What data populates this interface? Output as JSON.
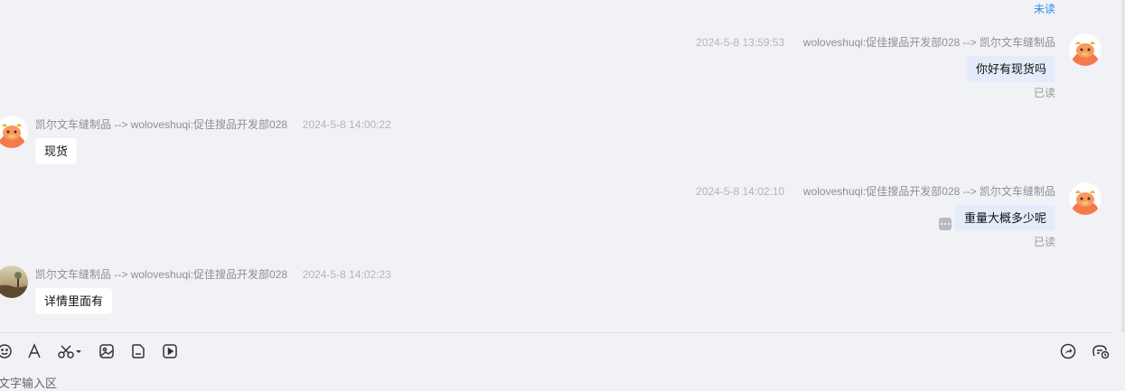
{
  "messages": [
    {
      "status": "未读"
    },
    {
      "direction": "out",
      "time": "2024-5-8 13:59:53",
      "sender": "woloveshuqi:促佳搜品开发部028 --> 凯尔文车缝制品",
      "text": "你好有现货吗",
      "status": "已读"
    },
    {
      "direction": "in",
      "sender": "凯尔文车缝制品 --> woloveshuqi:促佳搜品开发部028",
      "time": "2024-5-8 14:00:22",
      "text": "现货"
    },
    {
      "direction": "out",
      "time": "2024-5-8 14:02:10",
      "sender": "woloveshuqi:促佳搜品开发部028 --> 凯尔文车缝制品",
      "text": "重量大概多少呢",
      "status": "已读"
    },
    {
      "direction": "in",
      "sender": "凯尔文车缝制品 --> woloveshuqi:促佳搜品开发部028",
      "time": "2024-5-8 14:02:23",
      "text": "详情里面有"
    }
  ],
  "toolbar": {
    "left_icons": [
      "emoji-icon",
      "font-icon",
      "scissors-icon",
      "image-icon",
      "file-icon",
      "video-icon"
    ],
    "right_icons": [
      "share-icon",
      "quick-reply-icon"
    ]
  },
  "input": {
    "placeholder": "文字输入区"
  },
  "colors": {
    "background": "#f1f2f6",
    "mine_bubble": "#e4ecfb",
    "their_bubble": "#ffffff",
    "unread": "#2f8fe6",
    "avatar_orange": "#f37a4b"
  }
}
